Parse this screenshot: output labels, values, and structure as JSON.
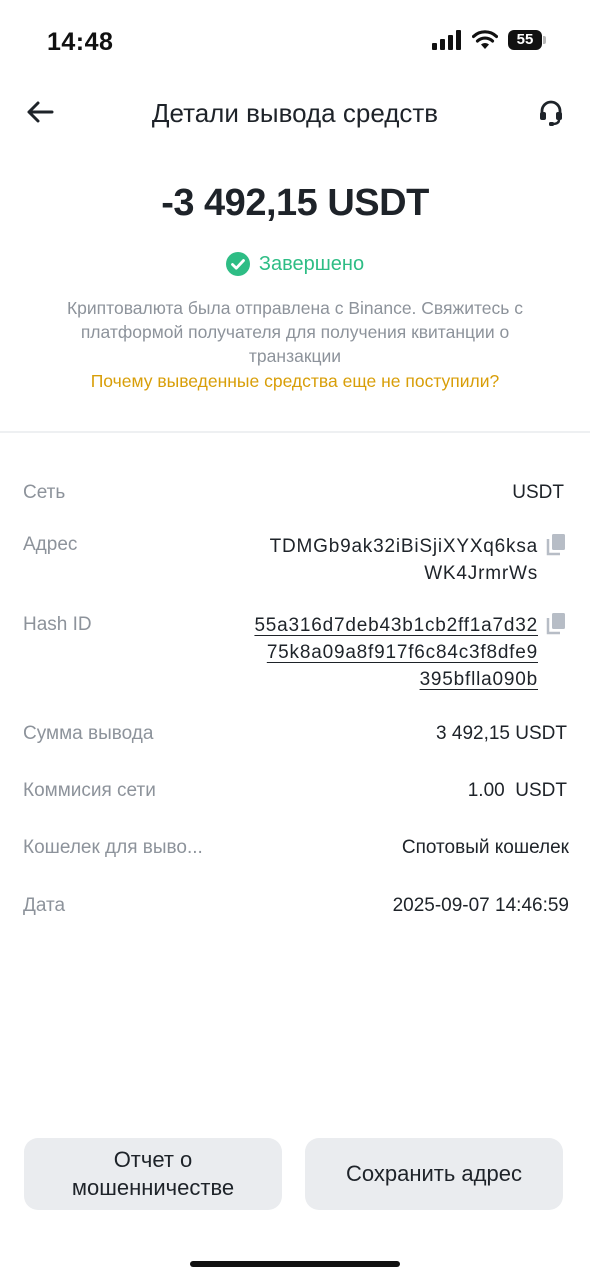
{
  "status_bar": {
    "time": "14:48",
    "battery": "55"
  },
  "header": {
    "title": "Детали вывода средств",
    "back_icon": "arrow-left-icon",
    "support_icon": "headset-icon"
  },
  "summary": {
    "amount": "-3 492,15 USDT",
    "status": "Завершено",
    "status_color": "#2ebd85",
    "description": "Криптовалюта была отправлена с Binance. Свяжитесь с платформой получателя для получения квитанции о транзакции",
    "help_link": "Почему выведенные средства еще не поступили?",
    "help_link_color": "#d89e08"
  },
  "details": {
    "network": {
      "label": "Сеть",
      "value": "USDT"
    },
    "address": {
      "label": "Адрес",
      "line1": "TDMGb9ak32iBiSjiXYXq6ksa",
      "line2": "WK4JrmrWs"
    },
    "hash": {
      "label": "Hash ID",
      "line1": "55a316d7deb43b1cb2ff1a7d32",
      "line2": "75k8a09a8f917f6c84c3f8dfe9",
      "line3": "395bflla090b"
    },
    "amount": {
      "label": "Сумма вывода",
      "value": "3 492,15 USDT"
    },
    "fee": {
      "label": "Коммисия сети",
      "value": "1.00  USDT"
    },
    "wallet": {
      "label": "Кошелек для выво...",
      "value": "Спотовый кошелек"
    },
    "date": {
      "label": "Дата",
      "value": "2025-09-07 14:46:59"
    }
  },
  "actions": {
    "report_line1": "Отчет о",
    "report_line2": "мошенничестве",
    "save_address": "Сохранить адрес"
  }
}
